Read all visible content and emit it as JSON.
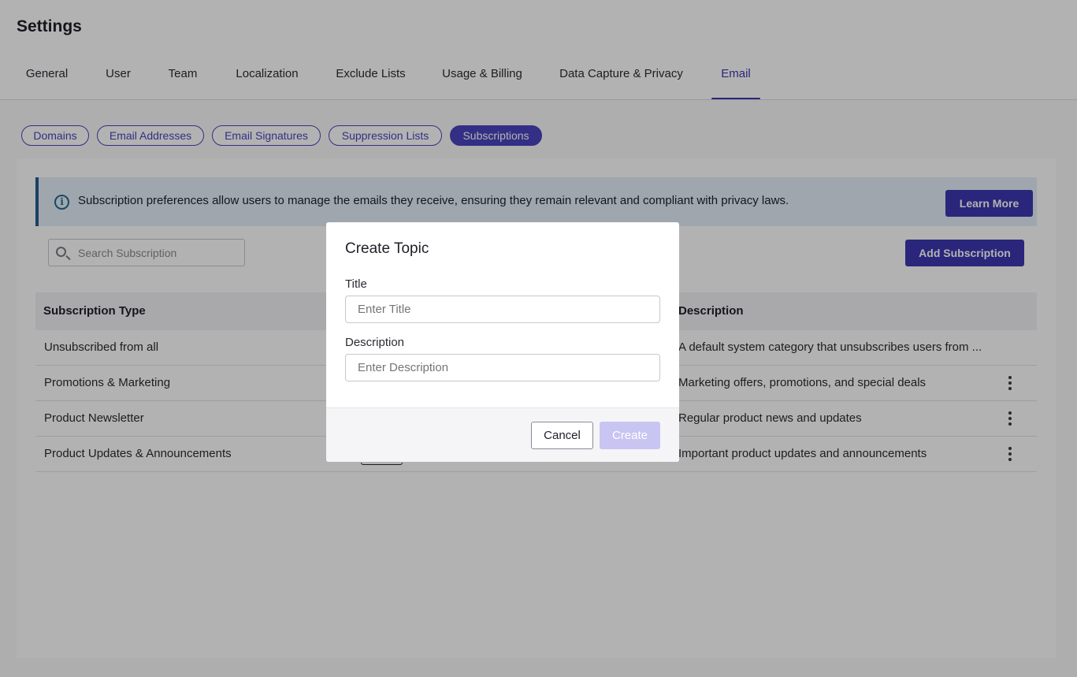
{
  "page": {
    "title": "Settings"
  },
  "tabs": [
    {
      "label": "General"
    },
    {
      "label": "User"
    },
    {
      "label": "Team"
    },
    {
      "label": "Localization"
    },
    {
      "label": "Exclude Lists"
    },
    {
      "label": "Usage & Billing"
    },
    {
      "label": "Data Capture & Privacy"
    },
    {
      "label": "Email",
      "active": true
    }
  ],
  "subtabs": [
    {
      "label": "Domains"
    },
    {
      "label": "Email Addresses"
    },
    {
      "label": "Email Signatures"
    },
    {
      "label": "Suppression Lists"
    },
    {
      "label": "Subscriptions",
      "active": true
    }
  ],
  "banner": {
    "icon": "info-circle-icon",
    "text": "Subscription preferences allow users to manage the emails they receive, ensuring they remain relevant and compliant with privacy laws.",
    "button_label": "Learn More"
  },
  "search": {
    "placeholder": "Search Subscription",
    "icon": "search-icon"
  },
  "add_button_label": "Add Subscription",
  "table": {
    "columns": [
      "Subscription Type",
      "Description"
    ],
    "rows": [
      {
        "type": "Unsubscribed from all",
        "description": "A default system category that unsubscribes users from ...",
        "has_menu": false
      },
      {
        "type": "Promotions & Marketing",
        "description": "Marketing offers, promotions, and special deals",
        "has_menu": true
      },
      {
        "type": "Product Newsletter",
        "description": "Regular product news and updates",
        "has_menu": true
      },
      {
        "type": "Product Updates & Announcements",
        "description": "Important product updates and announcements",
        "has_menu": true
      }
    ]
  },
  "modal": {
    "title": "Create Topic",
    "title_field": {
      "label": "Title",
      "placeholder": "Enter Title",
      "value": ""
    },
    "description_field": {
      "label": "Description",
      "placeholder": "Enter Description",
      "value": ""
    },
    "cancel_label": "Cancel",
    "create_label": "Create"
  },
  "colors": {
    "accent": "#3d37b0",
    "create_disabled": "#c8c5f2",
    "banner_bg": "#e4eef9"
  }
}
